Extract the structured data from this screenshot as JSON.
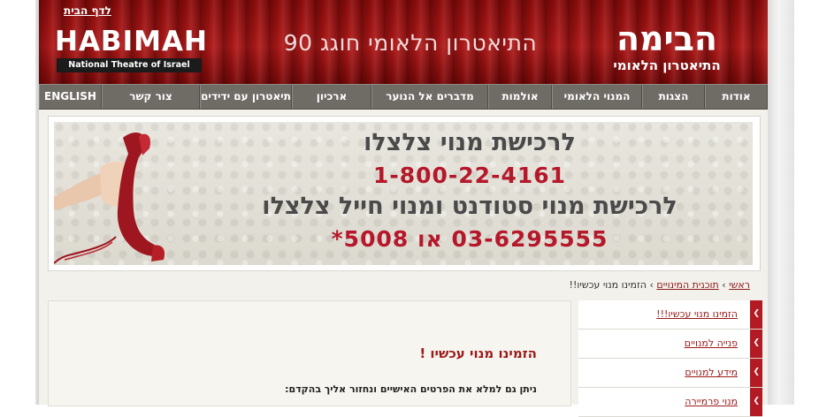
{
  "header": {
    "home_link": "לדף הבית",
    "logo_en_name": "HABIMAH",
    "logo_en_sub": "National Theatre of Israel",
    "center_title": "התיאטרון הלאומי חוגג 90",
    "logo_he_name": "הבימה",
    "logo_he_sub": "התיאטרון הלאומי"
  },
  "nav": {
    "items": [
      "אודות",
      "הצגות",
      "המנוי הלאומי",
      "אולמות",
      "מדברים אל הנוער",
      "ארכיון",
      "תיאטרון עם ידידים",
      "צור קשר",
      "ENGLISH"
    ]
  },
  "banner": {
    "line1": "לרכישת מנוי צלצלו",
    "line2": "1-800-22-4161",
    "line3": "לרכישת מנוי סטודנט ומנוי חייל צלצלו",
    "line4": "03-6295555 או 5008*"
  },
  "breadcrumb": {
    "home": "ראשי",
    "section": "תוכנית המינויים",
    "current": "הזמינו מנוי עכשיו!!",
    "sep": "›"
  },
  "content": {
    "title": "הזמינו מנוי עכשיו !",
    "text": "ניתן גם למלא את הפרטים האישיים ונחזור אליך בהקדם:"
  },
  "side_menu": {
    "items": [
      "הזמינו מנוי עכשיו!!!",
      "פנייה למנויים",
      "מידע למנויים",
      "מנוי פרמיירה"
    ],
    "accent": "#b21b23"
  }
}
